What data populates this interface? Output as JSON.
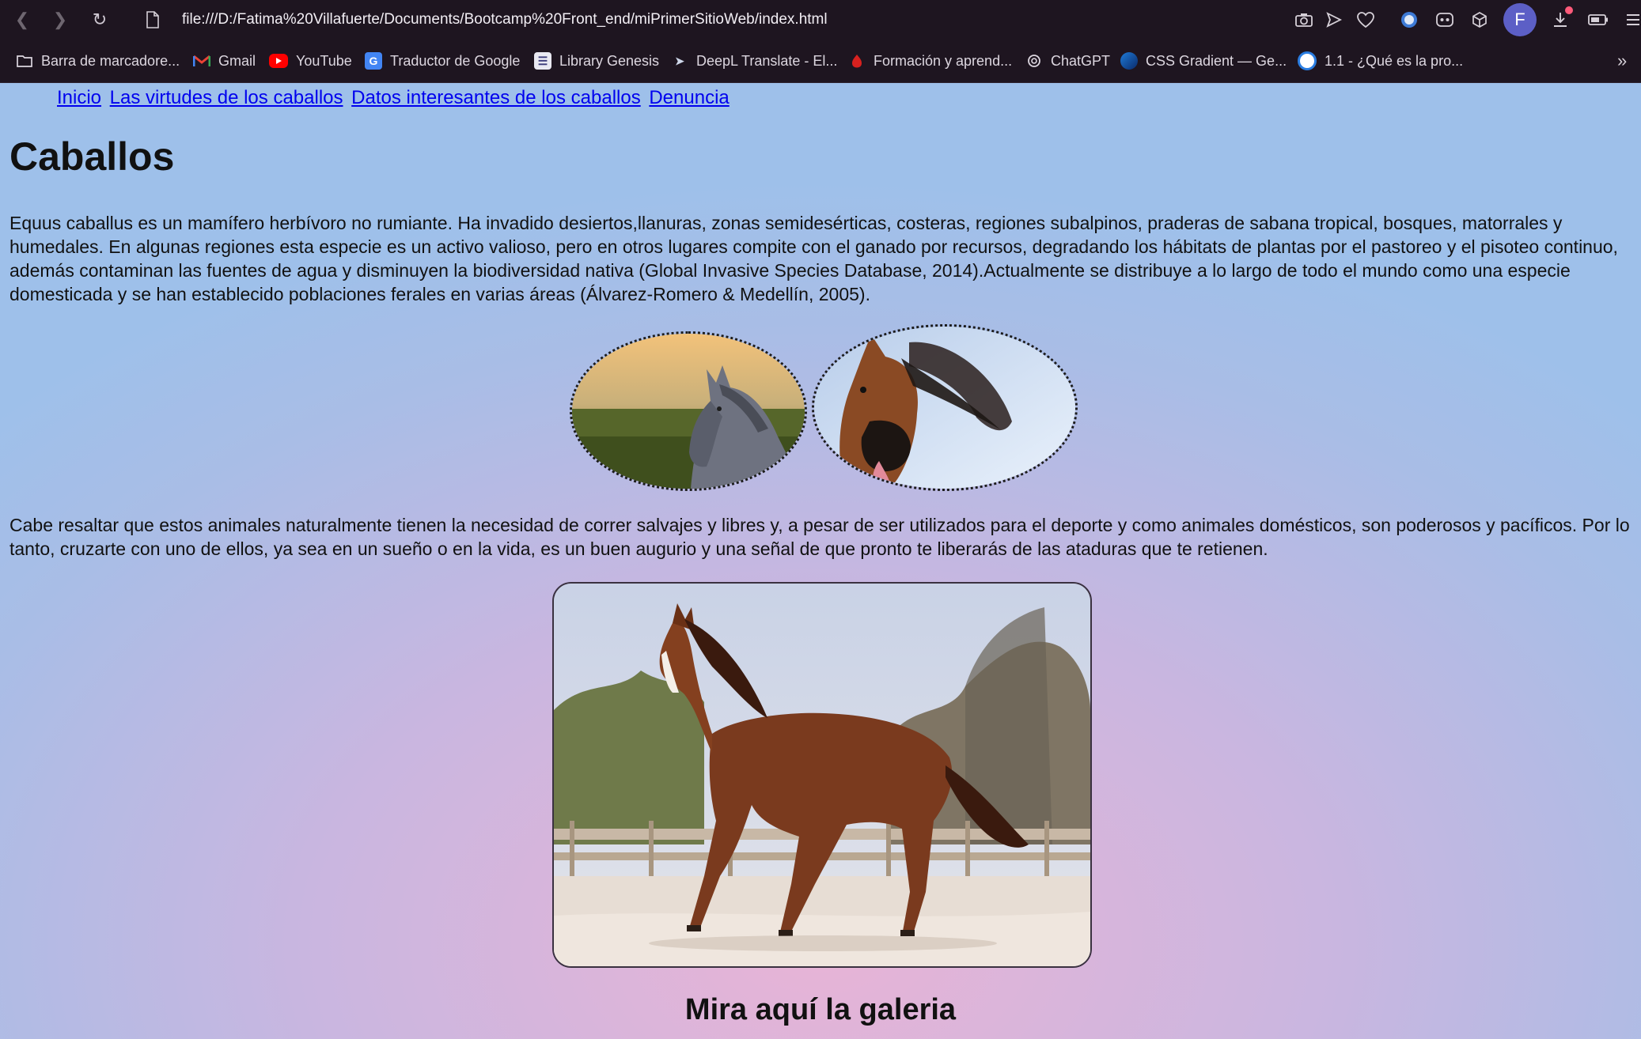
{
  "browser": {
    "url": "file:///D:/Fatima%20Villafuerte/Documents/Bootcamp%20Front_end/miPrimerSitioWeb/index.html",
    "profile_initial": "F",
    "bookmarks": [
      {
        "label": "Barra de marcadore...",
        "icon": "folder-icon"
      },
      {
        "label": "Gmail",
        "icon": "gmail-icon"
      },
      {
        "label": "YouTube",
        "icon": "youtube-icon"
      },
      {
        "label": "Traductor de Google",
        "icon": "google-translate-icon"
      },
      {
        "label": "Library Genesis",
        "icon": "library-icon"
      },
      {
        "label": "DeepL Translate - El...",
        "icon": "deepl-icon"
      },
      {
        "label": "Formación y aprend...",
        "icon": "formacion-icon"
      },
      {
        "label": "ChatGPT",
        "icon": "chatgpt-icon"
      },
      {
        "label": "CSS Gradient — Ge...",
        "icon": "css-gradient-icon"
      },
      {
        "label": "1.1 - ¿Qué es la pro...",
        "icon": "globe-icon"
      }
    ]
  },
  "nav": {
    "links": [
      "Inicio",
      "Las virtudes de los caballos",
      "Datos interesantes de los caballos",
      "Denuncia"
    ]
  },
  "page": {
    "title": "Caballos",
    "paragraph1": "Equus caballus es un mamífero herbívoro no rumiante. Ha invadido desiertos,llanuras, zonas semidesérticas, costeras, regiones subalpinos, praderas de sabana tropical, bosques, matorrales y humedales. En algunas regiones esta especie es un activo valioso, pero en otros lugares compite con el ganado por recursos, degradando los hábitats de plantas por el pastoreo y el pisoteo continuo, además contaminan las fuentes de agua y disminuyen la biodiversidad nativa (Global Invasive Species Database, 2014).Actualmente se distribuye a lo largo de todo el mundo como una especie domesticada y se han establecido poblaciones ferales en varias áreas (Álvarez-Romero & Medellín, 2005).",
    "paragraph2": "Cabe resaltar que estos animales naturalmente tienen la necesidad de correr salvajes y libres y, a pesar de ser utilizados para el deporte y como animales domésticos, son poderosos y pacíficos. Por lo tanto, cruzarte con uno de ellos, ya sea en un sueño o en la vida, es un buen augurio y una señal de que pronto te liberarás de las ataduras que te retienen.",
    "gallery_heading": "Mira aquí la galeria"
  }
}
